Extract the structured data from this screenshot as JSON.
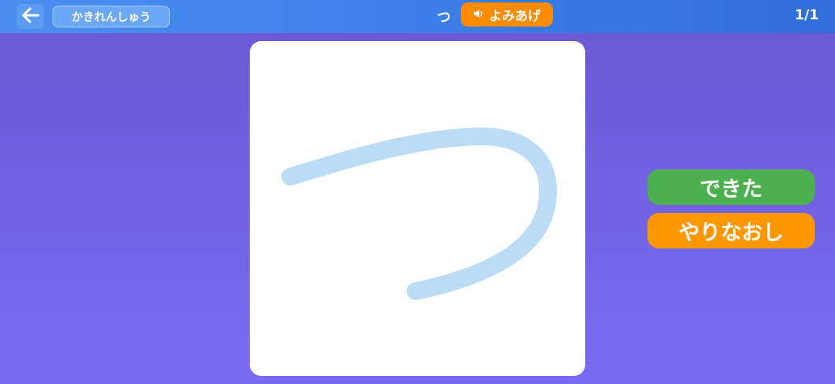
{
  "header": {
    "back_icon": "arrow-left-icon",
    "mode_label": "かきれんしゅう",
    "current_character": "つ",
    "read_aloud_label": "よみあげ",
    "speaker_icon": "speaker-icon",
    "page_counter": "1/1"
  },
  "canvas": {
    "character": "つ",
    "guide_color": "#bcdcf5"
  },
  "actions": {
    "done_label": "できた",
    "retry_label": "やりなおし"
  },
  "colors": {
    "header_blue": "#3c7fe8",
    "accent_orange": "#ff8c00",
    "done_green": "#4caf50",
    "retry_orange": "#ff9800",
    "background_purple": "#7060e0"
  }
}
